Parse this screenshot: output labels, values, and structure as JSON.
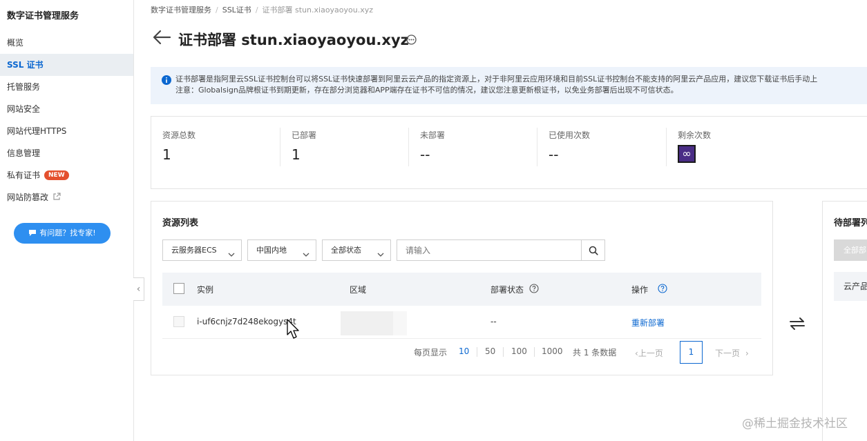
{
  "sidebar": {
    "title": "数字证书管理服务",
    "items": [
      {
        "label": "概览"
      },
      {
        "label": "SSL 证书"
      },
      {
        "label": "托管服务"
      },
      {
        "label": "网站安全"
      },
      {
        "label": "网站代理HTTPS"
      },
      {
        "label": "信息管理"
      },
      {
        "label": "私有证书",
        "badge": "NEW"
      },
      {
        "label": "网站防篡改"
      }
    ],
    "help_button": "有问题？找专家!",
    "collapse_icon": "‹"
  },
  "breadcrumb": [
    "数字证书管理服务",
    "SSL证书",
    "证书部署 stun.xiaoyaoyou.xyz"
  ],
  "page": {
    "title": "证书部署 stun.xiaoyaoyou.xyz"
  },
  "notice": {
    "line1": "证书部署是指阿里云SSL证书控制台可以将SSL证书快速部署到阿里云云产品的指定资源上，对于非阿里云应用环境和目前SSL证书控制台不能支持的阿里云产品应用，建议您下载证书后手动上",
    "line2": "注意：Globalsign品牌根证书到期更新，存在部分浏览器和APP端存在证书不可信的情况，建议您注意更新根证书，以免业务部署后出现不可信状态。"
  },
  "stats": [
    {
      "label": "资源总数",
      "value": "1"
    },
    {
      "label": "已部署",
      "value": "1"
    },
    {
      "label": "未部署",
      "value": "--"
    },
    {
      "label": "已使用次数",
      "value": "--"
    },
    {
      "label": "剩余次数",
      "value": "∞"
    }
  ],
  "resource_list": {
    "title": "资源列表",
    "filters": {
      "product": "云服务器ECS",
      "region": "中国内地",
      "status": "全部状态",
      "search_placeholder": "请输入"
    },
    "columns": [
      "实例",
      "区域",
      "部署状态",
      "操作"
    ],
    "rows": [
      {
        "instance": "i-uf6cnjz7d248ekogys4t",
        "region": "",
        "status": "--",
        "action": "重新部署"
      }
    ],
    "pagination": {
      "page_size_label": "每页显示",
      "page_sizes": [
        "10",
        "50",
        "100",
        "1000"
      ],
      "total_text": "共 1 条数据",
      "prev": "上一页",
      "next": "下一页",
      "current_page": "1"
    }
  },
  "pending": {
    "title": "待部署列",
    "button": "全部部",
    "row_label": "云产品"
  },
  "watermark": "@稀土掘金技术社区",
  "colors": {
    "accent": "#0b67d0",
    "help_button": "#2e8ff0",
    "badge": "#e4502e",
    "infinity": "#4a2d86"
  }
}
